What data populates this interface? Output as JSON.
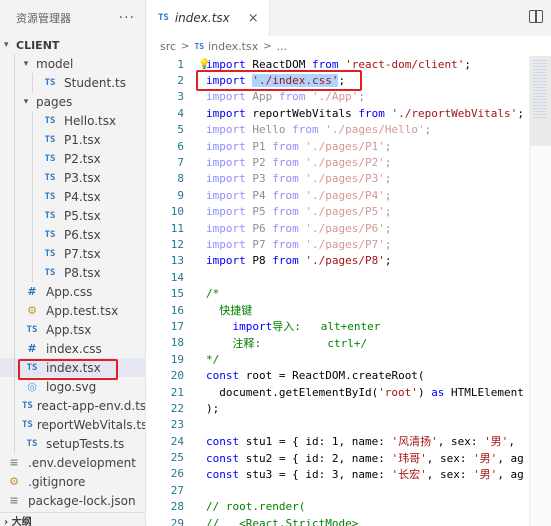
{
  "sidebar": {
    "title": "资源管理器",
    "more_label": "···",
    "section": "CLIENT",
    "items": [
      {
        "label": "model",
        "type": "folder",
        "depth": 1,
        "open": true
      },
      {
        "label": "Student.ts",
        "type": "ts",
        "depth": 2
      },
      {
        "label": "pages",
        "type": "folder",
        "depth": 1,
        "open": true
      },
      {
        "label": "Hello.tsx",
        "type": "ts",
        "depth": 2
      },
      {
        "label": "P1.tsx",
        "type": "ts",
        "depth": 2
      },
      {
        "label": "P2.tsx",
        "type": "ts",
        "depth": 2
      },
      {
        "label": "P3.tsx",
        "type": "ts",
        "depth": 2
      },
      {
        "label": "P4.tsx",
        "type": "ts",
        "depth": 2
      },
      {
        "label": "P5.tsx",
        "type": "ts",
        "depth": 2
      },
      {
        "label": "P6.tsx",
        "type": "ts",
        "depth": 2
      },
      {
        "label": "P7.tsx",
        "type": "ts",
        "depth": 2
      },
      {
        "label": "P8.tsx",
        "type": "ts",
        "depth": 2
      },
      {
        "label": "App.css",
        "type": "css",
        "depth": 1
      },
      {
        "label": "App.test.tsx",
        "type": "gear",
        "depth": 1
      },
      {
        "label": "App.tsx",
        "type": "ts",
        "depth": 1
      },
      {
        "label": "index.css",
        "type": "css",
        "depth": 1
      },
      {
        "label": "index.tsx",
        "type": "ts",
        "depth": 1,
        "selected": true
      },
      {
        "label": "logo.svg",
        "type": "logo",
        "depth": 1
      },
      {
        "label": "react-app-env.d.ts",
        "type": "ts",
        "depth": 1
      },
      {
        "label": "reportWebVitals.ts",
        "type": "ts",
        "depth": 1
      },
      {
        "label": "setupTests.ts",
        "type": "ts",
        "depth": 1
      },
      {
        "label": ".env.development",
        "type": "doc",
        "depth": 0
      },
      {
        "label": ".gitignore",
        "type": "gear",
        "depth": 0
      },
      {
        "label": "package-lock.json",
        "type": "doc",
        "depth": 0
      }
    ],
    "outline_label": "大纲"
  },
  "editor": {
    "tab": {
      "badge": "TS",
      "name": "index.tsx",
      "close": "×"
    },
    "breadcrumb": {
      "folder": "src",
      "sep": ">",
      "badge": "TS",
      "file": "index.tsx",
      "tail": "..."
    },
    "lines": [
      {
        "n": "1",
        "dim": false,
        "segs": [
          [
            "kw",
            "import"
          ],
          [
            "",
            " ReactDOM "
          ],
          [
            "kw",
            "from"
          ],
          [
            "",
            " "
          ],
          [
            "str",
            "'react-dom/client'"
          ],
          [
            "",
            ";"
          ]
        ]
      },
      {
        "n": "2",
        "dim": false,
        "segs": [
          [
            "kw",
            "import"
          ],
          [
            "",
            " "
          ],
          [
            "str hl",
            "'./index.css'"
          ],
          [
            "",
            ";"
          ]
        ]
      },
      {
        "n": "3",
        "dim": true,
        "segs": [
          [
            "kw",
            "import"
          ],
          [
            "",
            " App "
          ],
          [
            "kw",
            "from"
          ],
          [
            "",
            " "
          ],
          [
            "str",
            "'./App'"
          ],
          [
            "",
            ";"
          ]
        ]
      },
      {
        "n": "4",
        "dim": false,
        "segs": [
          [
            "kw",
            "import"
          ],
          [
            "",
            " reportWebVitals "
          ],
          [
            "kw",
            "from"
          ],
          [
            "",
            " "
          ],
          [
            "str",
            "'./reportWebVitals'"
          ],
          [
            "",
            ";"
          ]
        ]
      },
      {
        "n": "5",
        "dim": true,
        "segs": [
          [
            "kw",
            "import"
          ],
          [
            "",
            " Hello "
          ],
          [
            "kw",
            "from"
          ],
          [
            "",
            " "
          ],
          [
            "str",
            "'./pages/Hello'"
          ],
          [
            "",
            ";"
          ]
        ]
      },
      {
        "n": "6",
        "dim": true,
        "segs": [
          [
            "kw",
            "import"
          ],
          [
            "",
            " P1 "
          ],
          [
            "kw",
            "from"
          ],
          [
            "",
            " "
          ],
          [
            "str",
            "'./pages/P1'"
          ],
          [
            "",
            ";"
          ]
        ]
      },
      {
        "n": "7",
        "dim": true,
        "segs": [
          [
            "kw",
            "import"
          ],
          [
            "",
            " P2 "
          ],
          [
            "kw",
            "from"
          ],
          [
            "",
            " "
          ],
          [
            "str",
            "'./pages/P2'"
          ],
          [
            "",
            ";"
          ]
        ]
      },
      {
        "n": "8",
        "dim": true,
        "segs": [
          [
            "kw",
            "import"
          ],
          [
            "",
            " P3 "
          ],
          [
            "kw",
            "from"
          ],
          [
            "",
            " "
          ],
          [
            "str",
            "'./pages/P3'"
          ],
          [
            "",
            ";"
          ]
        ]
      },
      {
        "n": "9",
        "dim": true,
        "segs": [
          [
            "kw",
            "import"
          ],
          [
            "",
            " P4 "
          ],
          [
            "kw",
            "from"
          ],
          [
            "",
            " "
          ],
          [
            "str",
            "'./pages/P4'"
          ],
          [
            "",
            ";"
          ]
        ]
      },
      {
        "n": "10",
        "dim": true,
        "segs": [
          [
            "kw",
            "import"
          ],
          [
            "",
            " P5 "
          ],
          [
            "kw",
            "from"
          ],
          [
            "",
            " "
          ],
          [
            "str",
            "'./pages/P5'"
          ],
          [
            "",
            ";"
          ]
        ]
      },
      {
        "n": "11",
        "dim": true,
        "segs": [
          [
            "kw",
            "import"
          ],
          [
            "",
            " P6 "
          ],
          [
            "kw",
            "from"
          ],
          [
            "",
            " "
          ],
          [
            "str",
            "'./pages/P6'"
          ],
          [
            "",
            ";"
          ]
        ]
      },
      {
        "n": "12",
        "dim": true,
        "segs": [
          [
            "kw",
            "import"
          ],
          [
            "",
            " P7 "
          ],
          [
            "kw",
            "from"
          ],
          [
            "",
            " "
          ],
          [
            "str",
            "'./pages/P7'"
          ],
          [
            "",
            ";"
          ]
        ]
      },
      {
        "n": "13",
        "dim": false,
        "segs": [
          [
            "kw",
            "import"
          ],
          [
            "",
            " P8 "
          ],
          [
            "kw",
            "from"
          ],
          [
            "",
            " "
          ],
          [
            "str",
            "'./pages/P8'"
          ],
          [
            "",
            ";"
          ]
        ]
      },
      {
        "n": "14",
        "dim": false,
        "segs": []
      },
      {
        "n": "15",
        "dim": false,
        "segs": [
          [
            "cmt",
            "/*"
          ]
        ]
      },
      {
        "n": "16",
        "dim": false,
        "segs": [
          [
            "cmt",
            "  快捷键"
          ]
        ]
      },
      {
        "n": "17",
        "dim": false,
        "segs": [
          [
            "cmt",
            "    "
          ],
          [
            "kw",
            "import"
          ],
          [
            "cmt",
            "导入:   alt+enter"
          ]
        ]
      },
      {
        "n": "18",
        "dim": false,
        "segs": [
          [
            "cmt",
            "    注释:          ctrl+/"
          ]
        ]
      },
      {
        "n": "19",
        "dim": false,
        "segs": [
          [
            "cmt",
            "*/"
          ]
        ]
      },
      {
        "n": "20",
        "dim": false,
        "segs": [
          [
            "kw",
            "const"
          ],
          [
            "",
            " root = ReactDOM.createRoot("
          ]
        ]
      },
      {
        "n": "21",
        "dim": false,
        "segs": [
          [
            "",
            "  document.getElementById("
          ],
          [
            "str",
            "'root'"
          ],
          [
            "",
            ") "
          ],
          [
            "kw",
            "as"
          ],
          [
            "",
            " HTMLElement"
          ]
        ]
      },
      {
        "n": "22",
        "dim": false,
        "segs": [
          [
            "",
            ");"
          ]
        ]
      },
      {
        "n": "23",
        "dim": false,
        "segs": []
      },
      {
        "n": "24",
        "dim": false,
        "segs": [
          [
            "kw",
            "const"
          ],
          [
            "",
            " stu1 = { id: 1, name: "
          ],
          [
            "str",
            "'风清扬'"
          ],
          [
            "",
            ", sex: "
          ],
          [
            "str",
            "'男'"
          ],
          [
            "",
            ","
          ]
        ]
      },
      {
        "n": "25",
        "dim": false,
        "segs": [
          [
            "kw",
            "const"
          ],
          [
            "",
            " stu2 = { id: 2, name: "
          ],
          [
            "str",
            "'玮哥'"
          ],
          [
            "",
            ", sex: "
          ],
          [
            "str",
            "'男'"
          ],
          [
            "",
            ", ag"
          ]
        ]
      },
      {
        "n": "26",
        "dim": false,
        "segs": [
          [
            "kw",
            "const"
          ],
          [
            "",
            " stu3 = { id: 3, name: "
          ],
          [
            "str",
            "'长宏'"
          ],
          [
            "",
            ", sex: "
          ],
          [
            "str",
            "'男'"
          ],
          [
            "",
            ", ag"
          ]
        ]
      },
      {
        "n": "27",
        "dim": false,
        "segs": []
      },
      {
        "n": "28",
        "dim": false,
        "segs": [
          [
            "cmt",
            "// root.render("
          ]
        ]
      },
      {
        "n": "29",
        "dim": false,
        "segs": [
          [
            "cmt",
            "//   <React.StrictMode>"
          ]
        ]
      }
    ]
  },
  "colors": {
    "highlight_box": "#e02020",
    "keyword": "#0000ff",
    "string": "#a31515",
    "comment": "#008000"
  }
}
